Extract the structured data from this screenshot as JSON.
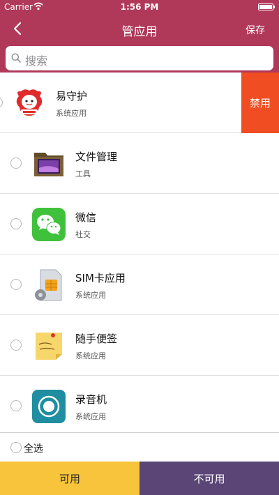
{
  "status_bar": {
    "carrier": "Carrier",
    "time": "1:56 PM"
  },
  "nav": {
    "title": "管应用",
    "save_label": "保存"
  },
  "search": {
    "placeholder": "搜索"
  },
  "apps": [
    {
      "name": "易守护",
      "category": "系统应用",
      "icon": "guardian-mascot-icon",
      "swipe_action": "禁用"
    },
    {
      "name": "文件管理",
      "category": "工具",
      "icon": "folder-icon"
    },
    {
      "name": "微信",
      "category": "社交",
      "icon": "wechat-icon"
    },
    {
      "name": "SIM卡应用",
      "category": "系统应用",
      "icon": "sim-card-icon"
    },
    {
      "name": "随手便签",
      "category": "系统应用",
      "icon": "sticky-note-icon"
    },
    {
      "name": "录音机",
      "category": "系统应用",
      "icon": "recorder-icon"
    }
  ],
  "select_all_label": "全选",
  "bottom": {
    "enable_label": "可用",
    "disable_label": "不可用"
  },
  "colors": {
    "brand": "#b0395a",
    "delete": "#f04d22",
    "enable": "#f7c43b",
    "disable": "#5b4576"
  }
}
